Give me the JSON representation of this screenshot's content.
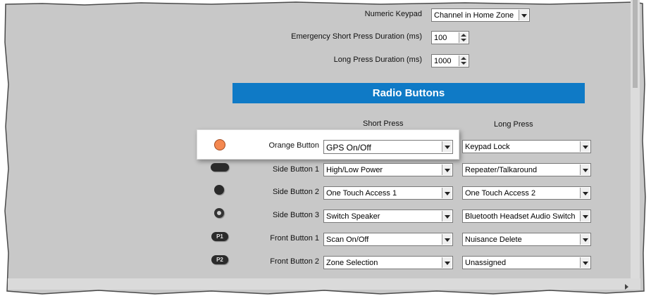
{
  "settings": {
    "numeric_keypad": {
      "label": "Numeric Keypad",
      "value": "Channel in Home Zone"
    },
    "emergency_short_press": {
      "label": "Emergency Short Press Duration (ms)",
      "value": "100"
    },
    "long_press_duration": {
      "label": "Long Press Duration (ms)",
      "value": "1000"
    }
  },
  "section_title": "Radio Buttons",
  "columns": {
    "short": "Short Press",
    "long": "Long Press"
  },
  "buttons": [
    {
      "name": "Orange Button",
      "short": "GPS On/Off",
      "long": "Keypad Lock",
      "icon": "orange-dot-icon"
    },
    {
      "name": "Side Button 1",
      "short": "High/Low Power",
      "long": "Repeater/Talkaround",
      "icon": "side-pill-icon"
    },
    {
      "name": "Side Button 2",
      "short": "One Touch Access 1",
      "long": "One Touch Access 2",
      "icon": "side-dot-icon"
    },
    {
      "name": "Side Button 3",
      "short": "Switch Speaker",
      "long": "Bluetooth Headset Audio Switch",
      "icon": "side-ring-icon"
    },
    {
      "name": "Front Button 1",
      "short": "Scan On/Off",
      "long": "Nuisance Delete",
      "icon": "p1-icon",
      "badge": "P1"
    },
    {
      "name": "Front Button 2",
      "short": "Zone Selection",
      "long": "Unassigned",
      "icon": "p2-icon",
      "badge": "P2"
    }
  ],
  "colors": {
    "panel": "#c8c8c8",
    "banner": "#0f7ac6",
    "orange": "#f48850"
  }
}
